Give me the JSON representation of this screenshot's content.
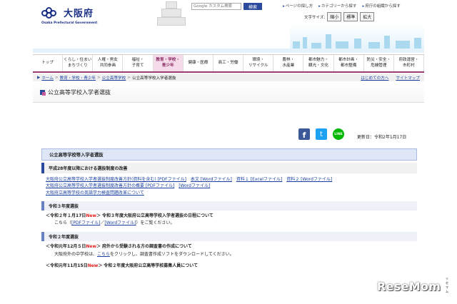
{
  "header": {
    "logo_text": "大阪府",
    "logo_en": "Osaka Prefectural Government",
    "search_placeholder": "Google カスタム検索",
    "search_button": "検索",
    "links": [
      "ページの探し方",
      "カテゴリーから探す",
      "府庁の組織から探す"
    ],
    "fontsize_label": "文字サイズ:",
    "fontsize_options": [
      "縮小",
      "標準",
      "拡大"
    ]
  },
  "nav": [
    "トップ",
    "くらし・住まい\nまちづくり",
    "人権・男女\n共同参画",
    "福祉・\n子育て",
    "教育・学校・\n青少年",
    "健康・医療",
    "商工・労働",
    "環境・\nリサイクル",
    "農林・\n水産業",
    "都市魅力・\n観光・文化",
    "都市計画・\n都市整備",
    "防災・安全・\n危機管理",
    "府政運営・\n市町村"
  ],
  "breadcrumb": {
    "items": [
      "ホーム",
      "教育・学校・青少年",
      "公立高等学校",
      "公立高等学校入学者選抜"
    ],
    "right": [
      "はじめての方へ",
      "サイトマップ"
    ]
  },
  "page_title": "公立高等学校入学者選抜",
  "updated": "更新日：令和2年1月17日",
  "social": {
    "facebook": "f",
    "twitter": "t",
    "line": "LINE"
  },
  "content": {
    "h2": "公立高等学校等入学者選抜",
    "h3": "平成28年度以降における選抜制度の改善",
    "links_row1": [
      "大阪府公立高等学校入学者選抜制度改善方針(資料を含む) [PDFファイル]",
      "本文 [Wordファイル]",
      "資料１ [Excelファイル]",
      "資料２ [Wordファイル]"
    ],
    "links_row2": [
      "大阪府公立高等学校入学者選抜制度改善方針の概要 [PDFファイル]",
      "[Wordファイル]"
    ],
    "links_row3": [
      "大阪府立高等学校の英語学力検査問題改革について"
    ],
    "sec_r3": "令和３年度選抜",
    "item_r3_date": "令和２年１月17日",
    "item_r3_new": "New",
    "item_r3_text": "令和３年度大阪府公立高等学校入学者選抜の日程について",
    "item_r3_sub_prefix": "こちら（",
    "item_r3_sub_pdf": "[PDFファイル]",
    "item_r3_sub_mid": "／",
    "item_r3_sub_word": "[Wordファイル]",
    "item_r3_sub_suffix": "）をご覧ください。",
    "sec_r2": "令和２年度選抜",
    "item_r2a_date": "令和元年12月５日",
    "item_r2a_new": "New",
    "item_r2a_text": "府外から受験される方の調査書の作成について",
    "item_r2a_sub_prefix": "大阪府外の中学校は、",
    "item_r2a_sub_link": "こちら",
    "item_r2a_sub_suffix": "をクリックし、調査書作成ソフトをダウンロードしてください。",
    "item_r2b_date": "令和元年11月15日",
    "item_r2b_new": "New",
    "item_r2b_text": "令和２年度大阪府公立高等学校募集人員について"
  },
  "watermark": "ReseMom",
  "watermark_sub": "リセマム"
}
